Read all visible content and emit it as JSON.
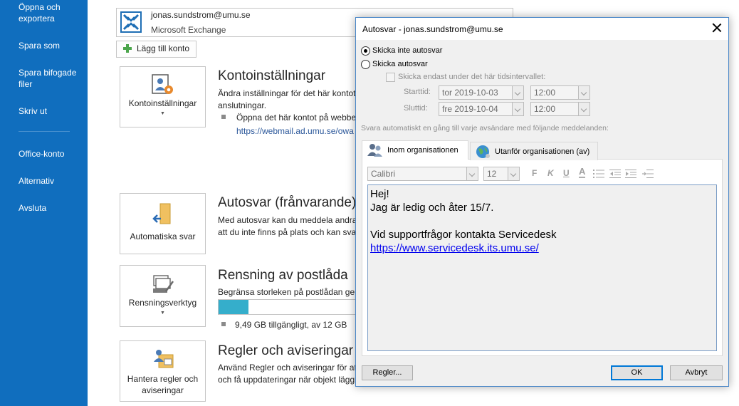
{
  "sidebar": {
    "items": [
      {
        "label": "Öppna och exportera"
      },
      {
        "label": "Spara som"
      },
      {
        "label": "Spara bifogade filer"
      },
      {
        "label": "Skriv ut"
      },
      {
        "label": "Office-konto"
      },
      {
        "label": "Alternativ"
      },
      {
        "label": "Avsluta"
      }
    ]
  },
  "account": {
    "email": "jonas.sundstrom@umu.se",
    "type": "Microsoft Exchange",
    "add_label": "Lägg till konto"
  },
  "sections": {
    "account_settings": {
      "tile_label": "Kontoinställningar",
      "title": "Kontoinställningar",
      "desc_line1": "Ändra inställningar för det här kontot",
      "desc_line2": "anslutningar.",
      "bullet": "Öppna det här kontot på webbe",
      "link": "https://webmail.ad.umu.se/owa"
    },
    "autoreply": {
      "tile_label": "Automatiska svar",
      "title": "Autosvar (frånvarande)",
      "desc_line1": "Med autosvar kan du meddela andra",
      "desc_line2": "att du inte finns på plats och kan sva"
    },
    "cleanup": {
      "tile_label": "Rensningsverktyg",
      "title": "Rensning av postlåda",
      "desc_line1": "Begränsa storleken på postlådan gen",
      "quota_text": "9,49 GB tillgängligt, av 12 GB",
      "quota_used_fraction": 0.21
    },
    "rules": {
      "tile_label_line1": "Hantera regler och",
      "tile_label_line2": "aviseringar",
      "title": "Regler och aviseringar",
      "desc_line1": "Använd Regler och aviseringar för att",
      "desc_line2": "och få uppdateringar när objekt lägg"
    }
  },
  "dialog": {
    "title": "Autosvar - jonas.sundstrom@umu.se",
    "radio_no_autoreply": "Skicka inte autosvar",
    "radio_autoreply": "Skicka autosvar",
    "checkbox_interval": "Skicka endast under det här tidsintervallet:",
    "start_label": "Starttid:",
    "end_label": "Sluttid:",
    "start_date": "tor 2019-10-03",
    "start_time": "12:00",
    "end_date": "fre 2019-10-04",
    "end_time": "12:00",
    "instruction": "Svara automatiskt en gång till varje avsändare med följande meddelanden:",
    "tab_inside": "Inom organisationen",
    "tab_outside": "Utanför organisationen (av)",
    "font_name": "Calibri",
    "font_size": "12",
    "fmt_bold": "F",
    "fmt_italic": "K",
    "fmt_underline": "U",
    "fmt_color": "A",
    "message_lines": [
      "Hej!",
      "Jag är ledig och åter 15/7.",
      "",
      "Vid supportfrågor kontakta Servicedesk"
    ],
    "message_link": "https://www.servicedesk.its.umu.se/",
    "rules_button": "Regler...",
    "ok_button": "OK",
    "cancel_button": "Avbryt"
  }
}
